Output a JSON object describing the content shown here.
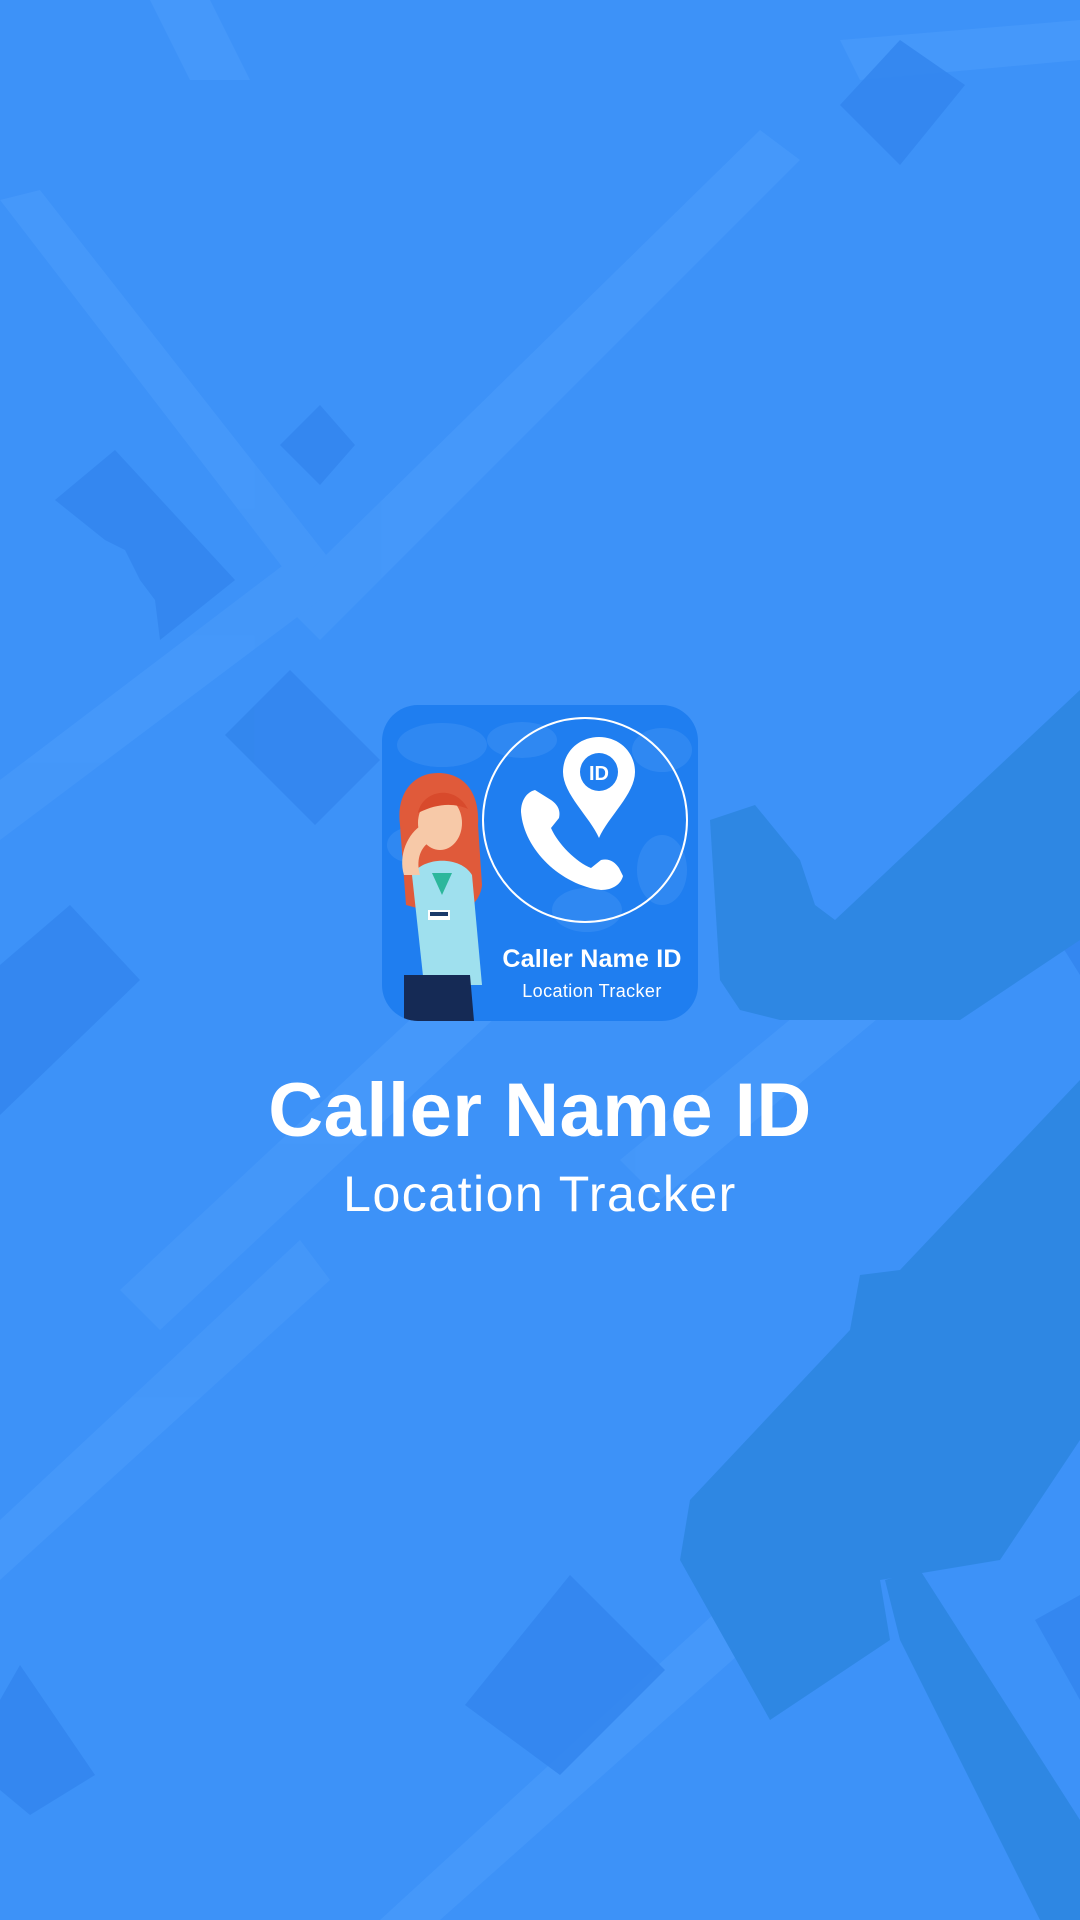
{
  "splash": {
    "background_color": "#3d92f8",
    "map_shape_color": "#2f86ea",
    "road_color": "#4a9bfa"
  },
  "app_icon": {
    "icon_name": "caller-id-location-app-icon",
    "title": "Caller Name ID",
    "subtitle": "Location Tracker",
    "badge_text": "ID",
    "background_color": "#1f7ef0"
  },
  "app_name": "Caller Name ID",
  "tagline": "Location Tracker"
}
